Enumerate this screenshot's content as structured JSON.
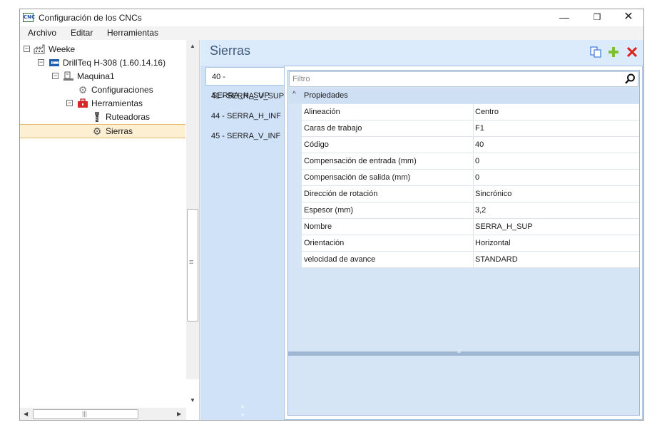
{
  "window": {
    "title": "Configuración de los CNCs",
    "app_icon_text": "CNC",
    "minimize_symbol": "—",
    "maximize_symbol": "❐",
    "close_symbol": "✕"
  },
  "menu": {
    "items": [
      "Archivo",
      "Editar",
      "Herramientas"
    ]
  },
  "tree": {
    "nodes": [
      {
        "label": "Weeke",
        "expander": "−",
        "icon": "factory-icon"
      },
      {
        "label": "DrillTeq H-308 (1.60.14.16)",
        "expander": "−",
        "icon": "machine-icon"
      },
      {
        "label": "Maquina1",
        "expander": "−",
        "icon": "machine-unit-icon"
      },
      {
        "label": "Configuraciones",
        "icon": "gear-icon"
      },
      {
        "label": "Herramientas",
        "expander": "−",
        "icon": "toolbox-icon"
      },
      {
        "label": "Ruteadoras",
        "icon": "router-bit-icon"
      },
      {
        "label": "Sierras",
        "icon": "saw-blade-icon",
        "selected": true
      }
    ]
  },
  "scrollbars": {
    "up_arrow": "▲",
    "down_arrow": "▼",
    "left_arrow": "◀",
    "right_arrow": "▶",
    "v_grip": "≡",
    "h_grip": "|||"
  },
  "section": {
    "title": "Sierras",
    "toolbar": {
      "copy_icon": "copy-icon",
      "add_icon": "add-icon",
      "delete_icon": "delete-icon"
    }
  },
  "tabs": {
    "items": [
      "40 - SERRA_H_SUP",
      "41 - SERRA_V_SUP",
      "44 - SERRA_H_INF",
      "45 - SERRA_V_INF"
    ],
    "active_index": 0,
    "nav_up": "▲",
    "nav_down": "▼"
  },
  "grid": {
    "filter_placeholder": "Filtro",
    "category": {
      "chevron": "^",
      "label": "Propiedades"
    },
    "rows": [
      {
        "name": "Alineación",
        "value": "Centro"
      },
      {
        "name": "Caras de trabajo",
        "value": "F1"
      },
      {
        "name": "Código",
        "value": "40"
      },
      {
        "name": "Compensación de entrada (mm)",
        "value": "0"
      },
      {
        "name": "Compensación de salida (mm)",
        "value": "0"
      },
      {
        "name": "Dirección de rotación",
        "value": "Sincrónico"
      },
      {
        "name": "Espesor (mm)",
        "value": "3,2"
      },
      {
        "name": "Nombre",
        "value": "SERRA_H_SUP"
      },
      {
        "name": "Orientación",
        "value": "Horizontal"
      },
      {
        "name": "velocidad de avance",
        "value": "STANDARD"
      }
    ],
    "splitter_grip": "/////"
  },
  "colors": {
    "content_bg": "#dcebfb",
    "tab_strip_bg": "#cfe2f8",
    "selection_bg": "#fdf0d2",
    "selection_border": "#e8b86a",
    "accent_green": "#7fc030",
    "accent_red": "#e0201c",
    "title_blue": "#3d5a7a"
  }
}
